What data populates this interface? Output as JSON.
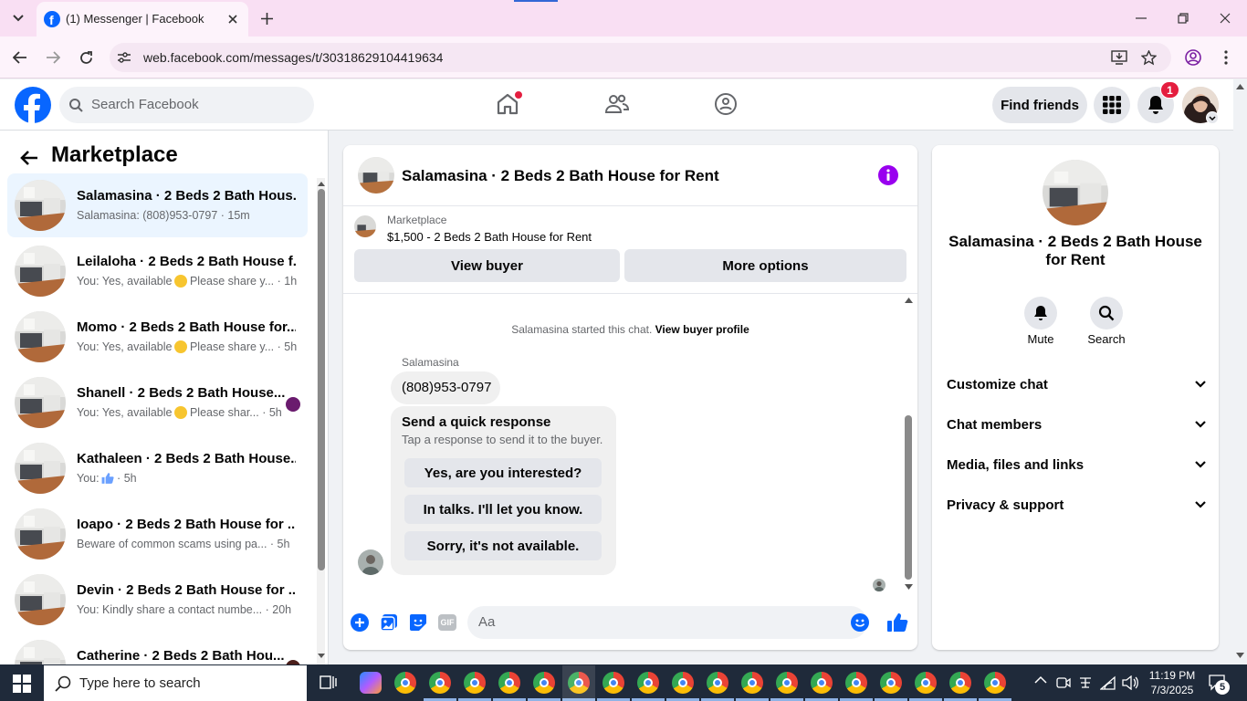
{
  "browser": {
    "tab_title": "(1) Messenger | Facebook",
    "url": "web.facebook.com/messages/t/30318629104419634"
  },
  "header": {
    "search_placeholder": "Search Facebook",
    "find_friends": "Find friends",
    "notification_count": "1"
  },
  "sidebar": {
    "title": "Marketplace",
    "conversations": [
      {
        "title": "Salamasina · 2 Beds 2 Bath Hous...",
        "preview": "Salamasina: (808)953-0797",
        "time": "15m",
        "emoji": "",
        "selected": true
      },
      {
        "title": "Leilaloha · 2 Beds 2 Bath House f...",
        "preview": "You: Yes, available",
        "preview2": " Please share y...",
        "time": "1h",
        "emoji": "smile"
      },
      {
        "title": "Momo · 2 Beds 2 Bath House for...",
        "preview": "You: Yes, available",
        "preview2": " Please share y...",
        "time": "5h",
        "emoji": "smile"
      },
      {
        "title": "Shanell · 2 Beds 2 Bath House...",
        "preview": "You: Yes, available",
        "preview2": " Please shar...",
        "time": "5h",
        "emoji": "smile"
      },
      {
        "title": "Kathaleen · 2 Beds 2 Bath House...",
        "preview": "You:",
        "preview2": "",
        "time": "5h",
        "emoji": "thumb"
      },
      {
        "title": "Ioapo · 2 Beds 2 Bath House for ...",
        "preview": "Beware of common scams using pa...",
        "time": "5h",
        "emoji": ""
      },
      {
        "title": "Devin · 2 Beds 2 Bath House for ...",
        "preview": "You: Kindly share a contact numbe...",
        "time": "20h",
        "emoji": ""
      },
      {
        "title": "Catherine · 2 Beds 2 Bath Hou...",
        "preview": "",
        "time": "",
        "emoji": ""
      }
    ]
  },
  "chat": {
    "header_title": "Salamasina · 2 Beds 2 Bath House for Rent",
    "listing_source": "Marketplace",
    "listing_text": "$1,500 - 2 Beds 2 Bath House for Rent",
    "view_buyer": "View buyer",
    "more_options": "More options",
    "started_text": "Salamasina started this chat.",
    "view_buyer_profile": "View buyer profile",
    "sender_name": "Salamasina",
    "message": "(808)953-0797",
    "quick_title": "Send a quick response",
    "quick_subtitle": "Tap a response to send it to the buyer.",
    "quick_responses": [
      "Yes, are you interested?",
      "In talks. I'll let you know.",
      "Sorry, it's not available."
    ],
    "composer_placeholder": "Aa",
    "gif_label": "GIF"
  },
  "info": {
    "title": "Salamasina · 2 Beds 2 Bath House for Rent",
    "mute": "Mute",
    "search": "Search",
    "sections": [
      "Customize chat",
      "Chat members",
      "Media, files and links",
      "Privacy & support"
    ]
  },
  "taskbar": {
    "search_placeholder": "Type here to search",
    "time": "11:19 PM",
    "date": "7/3/2025",
    "notification_count": "5"
  },
  "colors": {
    "fb_blue": "#0866ff",
    "purple_info": "#9900ef",
    "badge_red": "#e41e3f"
  }
}
